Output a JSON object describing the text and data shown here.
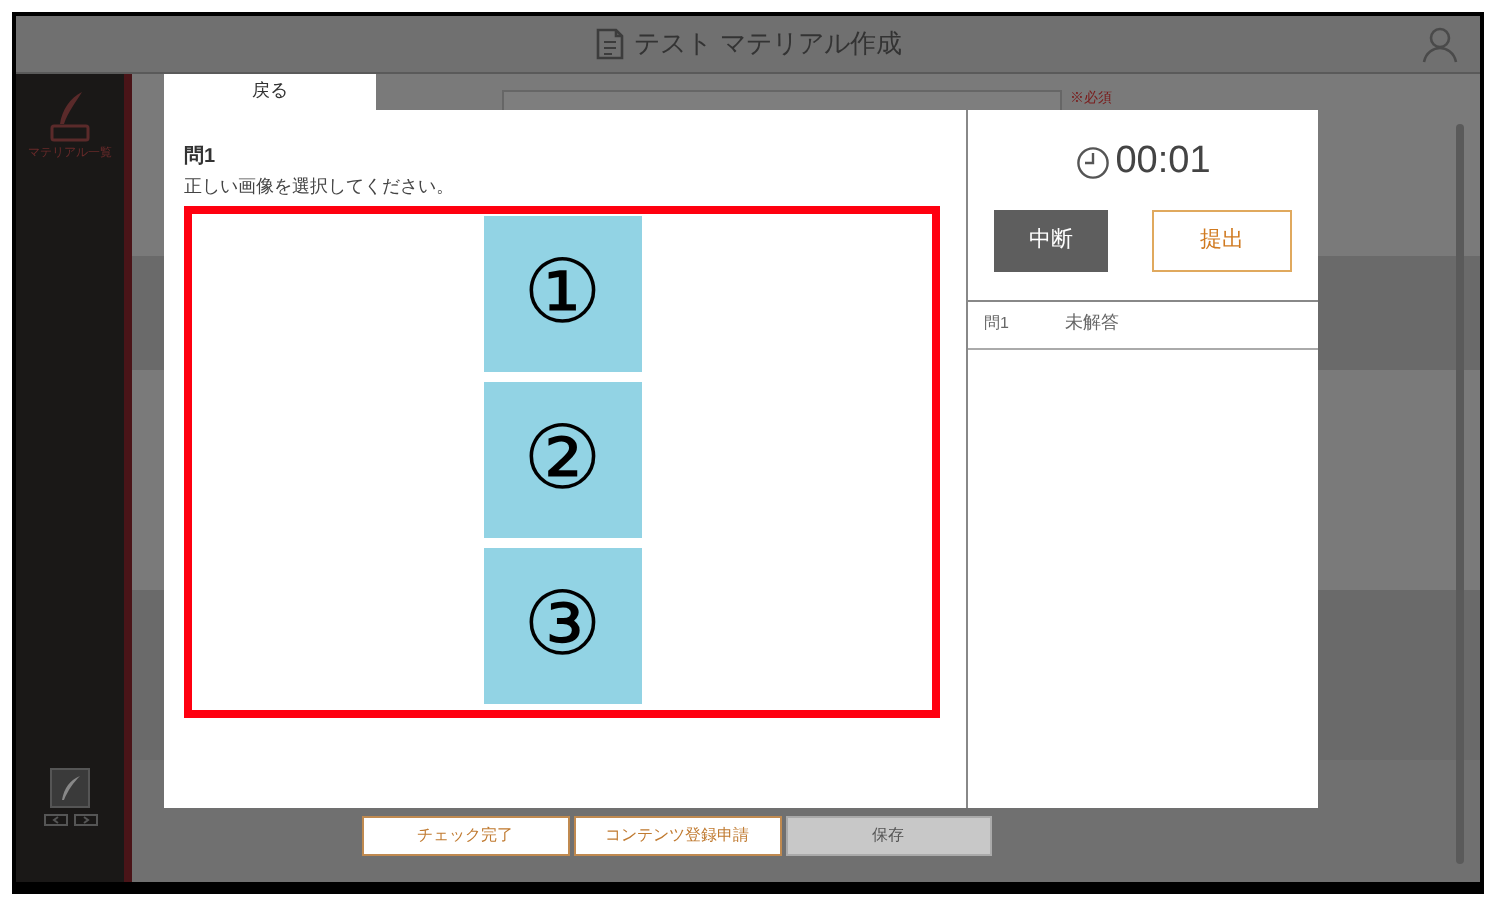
{
  "header": {
    "title": "テスト マテリアル作成"
  },
  "sidebar": {
    "items": [
      {
        "label": "マテリアル一覧"
      }
    ]
  },
  "back_tab": {
    "label": "戻る"
  },
  "form": {
    "required_note": "※必須"
  },
  "footer_buttons": [
    {
      "label": "チェック完了",
      "disabled": false
    },
    {
      "label": "コンテンツ登録申請",
      "disabled": false
    },
    {
      "label": "保存",
      "disabled": true
    }
  ],
  "dialog": {
    "question_title": "問1",
    "instruction": "正しい画像を選択してください。",
    "choices": [
      {
        "label": "①"
      },
      {
        "label": "②"
      },
      {
        "label": "③"
      }
    ],
    "timer": "00:01",
    "buttons": [
      {
        "label": "中断",
        "kind": "secondary"
      },
      {
        "label": "提出",
        "kind": "primary"
      }
    ],
    "answers": [
      {
        "question": "問1",
        "status": "未解答"
      }
    ]
  }
}
